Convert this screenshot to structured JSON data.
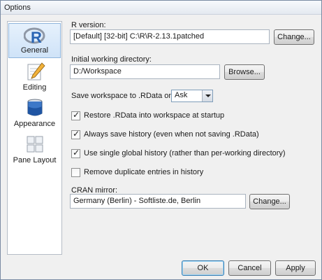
{
  "window": {
    "title": "Options"
  },
  "sidebar": {
    "items": [
      {
        "label": "General",
        "icon": "r-logo-icon",
        "selected": true
      },
      {
        "label": "Editing",
        "icon": "pencil-icon",
        "selected": false
      },
      {
        "label": "Appearance",
        "icon": "paint-bucket-icon",
        "selected": false
      },
      {
        "label": "Pane Layout",
        "icon": "pane-grid-icon",
        "selected": false
      }
    ]
  },
  "general": {
    "r_version": {
      "label": "R version:",
      "value": "[Default] [32-bit] C:\\R\\R-2.13.1patched",
      "change_button": "Change..."
    },
    "working_dir": {
      "label": "Initial working directory:",
      "value": "D:/Workspace",
      "browse_button": "Browse..."
    },
    "save_workspace": {
      "label": "Save workspace to .RData on exit:",
      "selected": "Ask"
    },
    "checkboxes": [
      {
        "label": "Restore .RData into workspace at startup",
        "checked": true
      },
      {
        "label": "Always save history (even when not saving .RData)",
        "checked": true
      },
      {
        "label": "Use single global history (rather than per-working directory)",
        "checked": true
      },
      {
        "label": "Remove duplicate entries in history",
        "checked": false
      }
    ],
    "cran_mirror": {
      "label": "CRAN mirror:",
      "value": "Germany (Berlin) - Softliste.de, Berlin",
      "change_button": "Change..."
    }
  },
  "footer": {
    "ok": "OK",
    "cancel": "Cancel",
    "apply": "Apply"
  }
}
